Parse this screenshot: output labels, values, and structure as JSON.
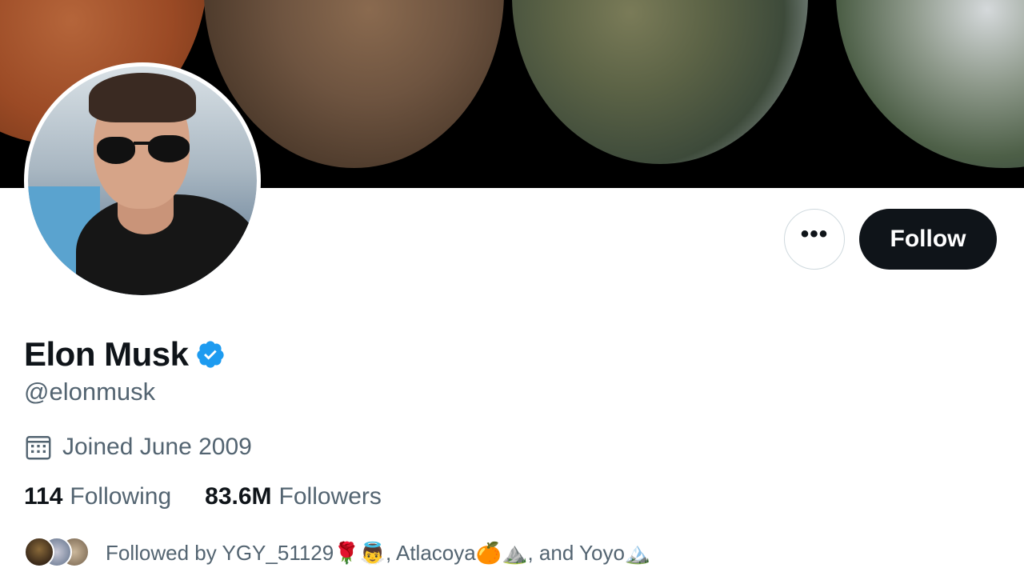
{
  "profile": {
    "display_name": "Elon Musk",
    "handle": "@elonmusk",
    "joined": "Joined June 2009",
    "verified": true
  },
  "actions": {
    "more_label": "•••",
    "follow_label": "Follow"
  },
  "stats": {
    "following_count": "114",
    "following_label": "Following",
    "followers_count": "83.6M",
    "followers_label": "Followers"
  },
  "followed_by": {
    "text": "Followed by YGY_51129🌹👼, Atlacoya🍊⛰️, and Yoyo🏔️"
  },
  "icons": {
    "verified": "verified-badge-icon",
    "calendar": "calendar-icon",
    "more": "more-horizontal-icon"
  },
  "colors": {
    "verified_blue": "#1d9bf0",
    "follow_button_bg": "#0f1419",
    "secondary_text": "#536471"
  }
}
